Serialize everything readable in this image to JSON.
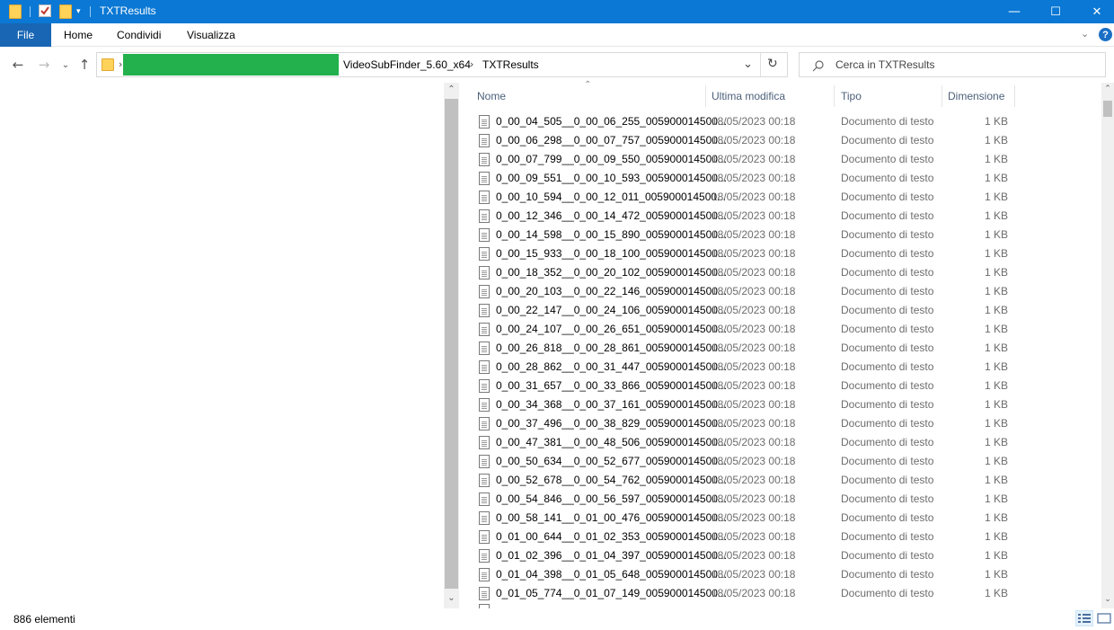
{
  "window": {
    "title": "TXTResults",
    "minimize": "—",
    "maximize": "☐",
    "close": "✕"
  },
  "ribbon": {
    "tabs": [
      "File",
      "Home",
      "Condividi",
      "Visualizza"
    ],
    "help": "?"
  },
  "address": {
    "crumbs": [
      "VideoSubFinder_5.60_x64",
      "TXTResults"
    ],
    "search_placeholder": "Cerca in TXTResults"
  },
  "columns": {
    "name": "Nome",
    "modified": "Ultima modifica",
    "type": "Tipo",
    "size": "Dimensione"
  },
  "files": [
    {
      "name": "0_00_04_505__0_00_06_255_005900014500...",
      "date": "18/05/2023 00:18",
      "type": "Documento di testo",
      "size": "1 KB"
    },
    {
      "name": "0_00_06_298__0_00_07_757_005900014500...",
      "date": "18/05/2023 00:18",
      "type": "Documento di testo",
      "size": "1 KB"
    },
    {
      "name": "0_00_07_799__0_00_09_550_005900014500...",
      "date": "18/05/2023 00:18",
      "type": "Documento di testo",
      "size": "1 KB"
    },
    {
      "name": "0_00_09_551__0_00_10_593_005900014500...",
      "date": "18/05/2023 00:18",
      "type": "Documento di testo",
      "size": "1 KB"
    },
    {
      "name": "0_00_10_594__0_00_12_011_005900014500...",
      "date": "18/05/2023 00:18",
      "type": "Documento di testo",
      "size": "1 KB"
    },
    {
      "name": "0_00_12_346__0_00_14_472_005900014500...",
      "date": "18/05/2023 00:18",
      "type": "Documento di testo",
      "size": "1 KB"
    },
    {
      "name": "0_00_14_598__0_00_15_890_005900014500...",
      "date": "18/05/2023 00:18",
      "type": "Documento di testo",
      "size": "1 KB"
    },
    {
      "name": "0_00_15_933__0_00_18_100_005900014500...",
      "date": "18/05/2023 00:18",
      "type": "Documento di testo",
      "size": "1 KB"
    },
    {
      "name": "0_00_18_352__0_00_20_102_005900014500...",
      "date": "18/05/2023 00:18",
      "type": "Documento di testo",
      "size": "1 KB"
    },
    {
      "name": "0_00_20_103__0_00_22_146_005900014500...",
      "date": "18/05/2023 00:18",
      "type": "Documento di testo",
      "size": "1 KB"
    },
    {
      "name": "0_00_22_147__0_00_24_106_005900014500...",
      "date": "18/05/2023 00:18",
      "type": "Documento di testo",
      "size": "1 KB"
    },
    {
      "name": "0_00_24_107__0_00_26_651_005900014500...",
      "date": "18/05/2023 00:18",
      "type": "Documento di testo",
      "size": "1 KB"
    },
    {
      "name": "0_00_26_818__0_00_28_861_005900014500...",
      "date": "18/05/2023 00:18",
      "type": "Documento di testo",
      "size": "1 KB"
    },
    {
      "name": "0_00_28_862__0_00_31_447_005900014500...",
      "date": "18/05/2023 00:18",
      "type": "Documento di testo",
      "size": "1 KB"
    },
    {
      "name": "0_00_31_657__0_00_33_866_005900014500...",
      "date": "18/05/2023 00:18",
      "type": "Documento di testo",
      "size": "1 KB"
    },
    {
      "name": "0_00_34_368__0_00_37_161_005900014500...",
      "date": "18/05/2023 00:18",
      "type": "Documento di testo",
      "size": "1 KB"
    },
    {
      "name": "0_00_37_496__0_00_38_829_005900014500...",
      "date": "18/05/2023 00:18",
      "type": "Documento di testo",
      "size": "1 KB"
    },
    {
      "name": "0_00_47_381__0_00_48_506_005900014500...",
      "date": "18/05/2023 00:18",
      "type": "Documento di testo",
      "size": "1 KB"
    },
    {
      "name": "0_00_50_634__0_00_52_677_005900014500...",
      "date": "18/05/2023 00:18",
      "type": "Documento di testo",
      "size": "1 KB"
    },
    {
      "name": "0_00_52_678__0_00_54_762_005900014500...",
      "date": "18/05/2023 00:18",
      "type": "Documento di testo",
      "size": "1 KB"
    },
    {
      "name": "0_00_54_846__0_00_56_597_005900014500...",
      "date": "18/05/2023 00:18",
      "type": "Documento di testo",
      "size": "1 KB"
    },
    {
      "name": "0_00_58_141__0_01_00_476_005900014500...",
      "date": "18/05/2023 00:18",
      "type": "Documento di testo",
      "size": "1 KB"
    },
    {
      "name": "0_01_00_644__0_01_02_353_005900014500...",
      "date": "18/05/2023 00:18",
      "type": "Documento di testo",
      "size": "1 KB"
    },
    {
      "name": "0_01_02_396__0_01_04_397_005900014500...",
      "date": "18/05/2023 00:18",
      "type": "Documento di testo",
      "size": "1 KB"
    },
    {
      "name": "0_01_04_398__0_01_05_648_005900014500...",
      "date": "18/05/2023 00:18",
      "type": "Documento di testo",
      "size": "1 KB"
    },
    {
      "name": "0_01_05_774__0_01_07_149_005900014500...",
      "date": "18/05/2023 00:18",
      "type": "Documento di testo",
      "size": "1 KB"
    }
  ],
  "status": {
    "count": "886 elementi"
  },
  "colors": {
    "titlebar": "#0a78d4",
    "file_tab": "#1966b4",
    "redacted": "#22b14c"
  }
}
